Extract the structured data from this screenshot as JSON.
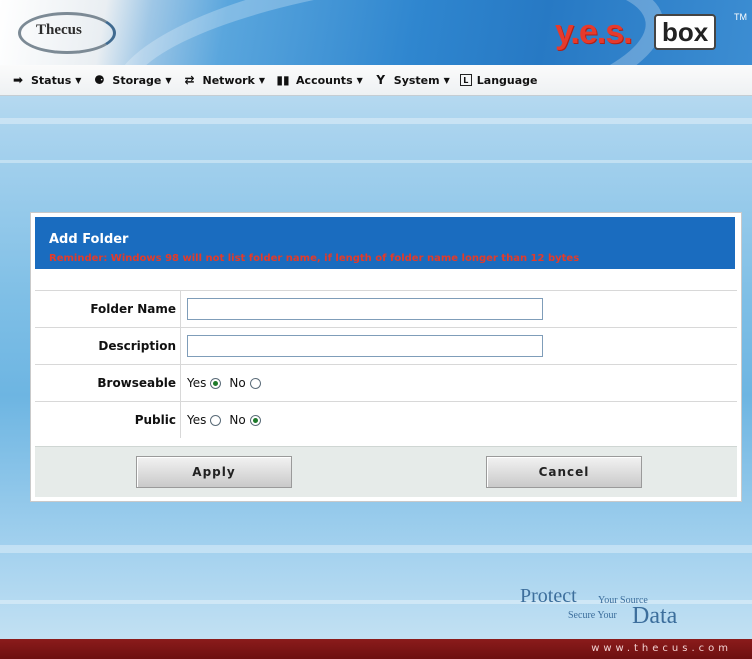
{
  "header": {
    "logo_left": "Thecus",
    "logo_right_yes": "y.e.s.",
    "logo_right_box": "box",
    "logo_tm": "TM"
  },
  "menu": [
    {
      "label": "Status",
      "icon": "status-icon",
      "has_caret": true
    },
    {
      "label": "Storage",
      "icon": "storage-icon",
      "has_caret": true
    },
    {
      "label": "Network",
      "icon": "network-icon",
      "has_caret": true
    },
    {
      "label": "Accounts",
      "icon": "accounts-icon",
      "has_caret": true
    },
    {
      "label": "System",
      "icon": "system-icon",
      "has_caret": true
    },
    {
      "label": "Language",
      "icon": "language-icon",
      "has_caret": false
    }
  ],
  "dialog": {
    "title": "Add Folder",
    "reminder": "Reminder: Windows 98 will not list folder name, if length of folder name longer than 12 bytes",
    "folder_name": {
      "label": "Folder Name",
      "value": ""
    },
    "description": {
      "label": "Description",
      "value": ""
    },
    "browseable": {
      "label": "Browseable",
      "yes": "Yes",
      "no": "No",
      "selected": "yes"
    },
    "public": {
      "label": "Public",
      "yes": "Yes",
      "no": "No",
      "selected": "no"
    },
    "apply_label": "Apply",
    "cancel_label": "Cancel"
  },
  "branding": {
    "protect": "Protect",
    "your_source": "Your Source",
    "secure_your": "Secure Your",
    "data": "Data"
  },
  "footer": {
    "site": "www.thecus.com"
  },
  "colors": {
    "header_blue": "#2f86cf",
    "dialog_head": "#1a6cbf",
    "reminder_red": "#e23b2a",
    "footer_red": "#7d1515"
  }
}
